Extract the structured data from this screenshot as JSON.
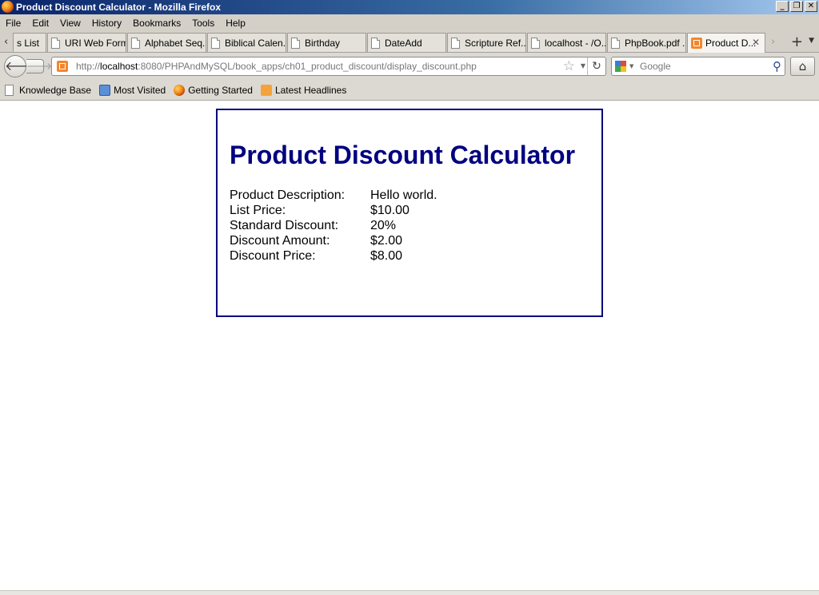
{
  "window": {
    "title": "Product Discount Calculator - Mozilla Firefox"
  },
  "menu": [
    "File",
    "Edit",
    "View",
    "History",
    "Bookmarks",
    "Tools",
    "Help"
  ],
  "tabs": [
    {
      "label": "s List",
      "active": false
    },
    {
      "label": "URI Web Form",
      "active": false
    },
    {
      "label": "Alphabet Seq...",
      "active": false
    },
    {
      "label": "Biblical Calen...",
      "active": false
    },
    {
      "label": "Birthday",
      "active": false
    },
    {
      "label": "DateAdd",
      "active": false
    },
    {
      "label": "Scripture Ref...",
      "active": false
    },
    {
      "label": "localhost - /O...",
      "active": false
    },
    {
      "label": "PhpBook.pdf ...",
      "active": false
    },
    {
      "label": "Product D...",
      "active": true
    }
  ],
  "address": {
    "prefix": "http://",
    "host": "localhost",
    "rest": ":8080/PHPAndMySQL/book_apps/ch01_product_discount/display_discount.php"
  },
  "search": {
    "placeholder": "Google"
  },
  "bookmarks": [
    {
      "label": "Knowledge Base",
      "icon": "page-icon"
    },
    {
      "label": "Most Visited",
      "icon": "most-visited-icon"
    },
    {
      "label": "Getting Started",
      "icon": "firefox-icon"
    },
    {
      "label": "Latest Headlines",
      "icon": "rss-icon"
    }
  ],
  "page": {
    "heading": "Product Discount Calculator",
    "rows": [
      {
        "label": "Product Description:",
        "value": "Hello world."
      },
      {
        "label": "List Price:",
        "value": "$10.00"
      },
      {
        "label": "Standard Discount:",
        "value": "20%"
      },
      {
        "label": "Discount Amount:",
        "value": "$2.00"
      },
      {
        "label": "Discount Price:",
        "value": "$8.00"
      }
    ]
  },
  "colors": {
    "heading": "#000080",
    "box_border": "#000080"
  }
}
